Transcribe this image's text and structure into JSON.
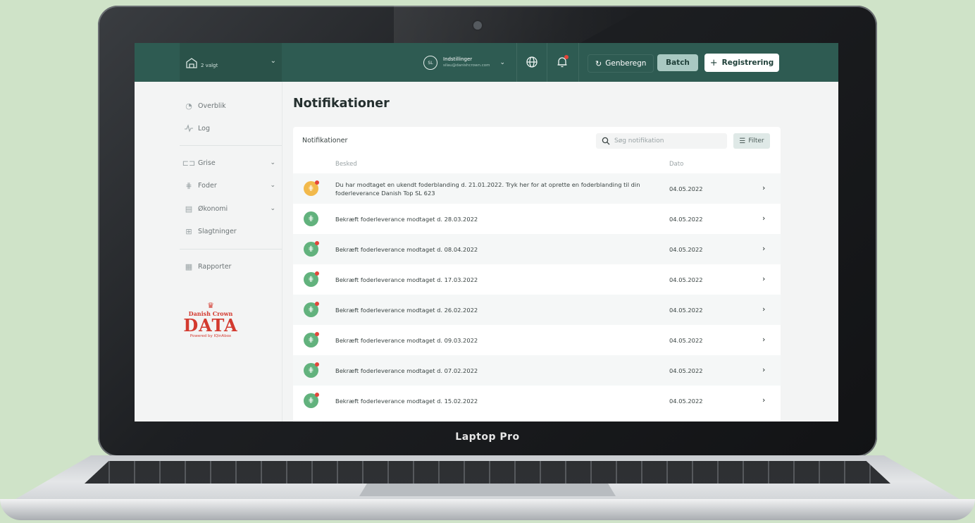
{
  "device": {
    "brand_label": "Laptop Pro"
  },
  "topbar": {
    "farm_label": "2 valgt",
    "settings_title": "Indstillinger",
    "settings_email": "silau@danishcrown.com",
    "avatar_initials": "SL",
    "genberegn_label": "Genberegn",
    "batch_label": "Batch",
    "registrering_label": "Registrering"
  },
  "sidebar": {
    "items": [
      {
        "label": "Overblik",
        "icon": "pie-chart-icon"
      },
      {
        "label": "Log",
        "icon": "pulse-icon"
      },
      {
        "label": "Grise",
        "icon": "pig-icon"
      },
      {
        "label": "Foder",
        "icon": "feed-icon"
      },
      {
        "label": "Økonomi",
        "icon": "economy-icon"
      },
      {
        "label": "Slagtninger",
        "icon": "truck-icon"
      },
      {
        "label": "Rapporter",
        "icon": "report-icon"
      }
    ]
  },
  "logo": {
    "name": "Danish Crown",
    "word": "DATA",
    "powered": "Powered by IQinAbox"
  },
  "main": {
    "page_title": "Notifikationer",
    "card_title": "Notifikationer",
    "search_placeholder": "Søg notifikation",
    "filter_label": "Filter",
    "columns": {
      "message": "Besked",
      "date": "Dato"
    },
    "rows": [
      {
        "message": "Du har modtaget en ukendt foderblanding d. 21.01.2022. Tryk her for at oprette en foderblanding til din foderleverance Danish Top SL 623",
        "date": "04.05.2022"
      },
      {
        "message": "Bekræft foderleverance modtaget d. 28.03.2022",
        "date": "04.05.2022"
      },
      {
        "message": "Bekræft foderleverance modtaget d. 08.04.2022",
        "date": "04.05.2022"
      },
      {
        "message": "Bekræft foderleverance modtaget d. 17.03.2022",
        "date": "04.05.2022"
      },
      {
        "message": "Bekræft foderleverance modtaget d. 26.02.2022",
        "date": "04.05.2022"
      },
      {
        "message": "Bekræft foderleverance modtaget d. 09.03.2022",
        "date": "04.05.2022"
      },
      {
        "message": "Bekræft foderleverance modtaget d. 07.02.2022",
        "date": "04.05.2022"
      },
      {
        "message": "Bekræft foderleverance modtaget d. 15.02.2022",
        "date": "04.05.2022"
      }
    ]
  },
  "colors": {
    "topbar": "#2e5b52",
    "accent": "#a9c9c2",
    "notify_dot": "#e4453a",
    "feed_icon": "#62b27d",
    "warn_icon": "#f2b94b",
    "logo_red": "#d33a2f"
  }
}
